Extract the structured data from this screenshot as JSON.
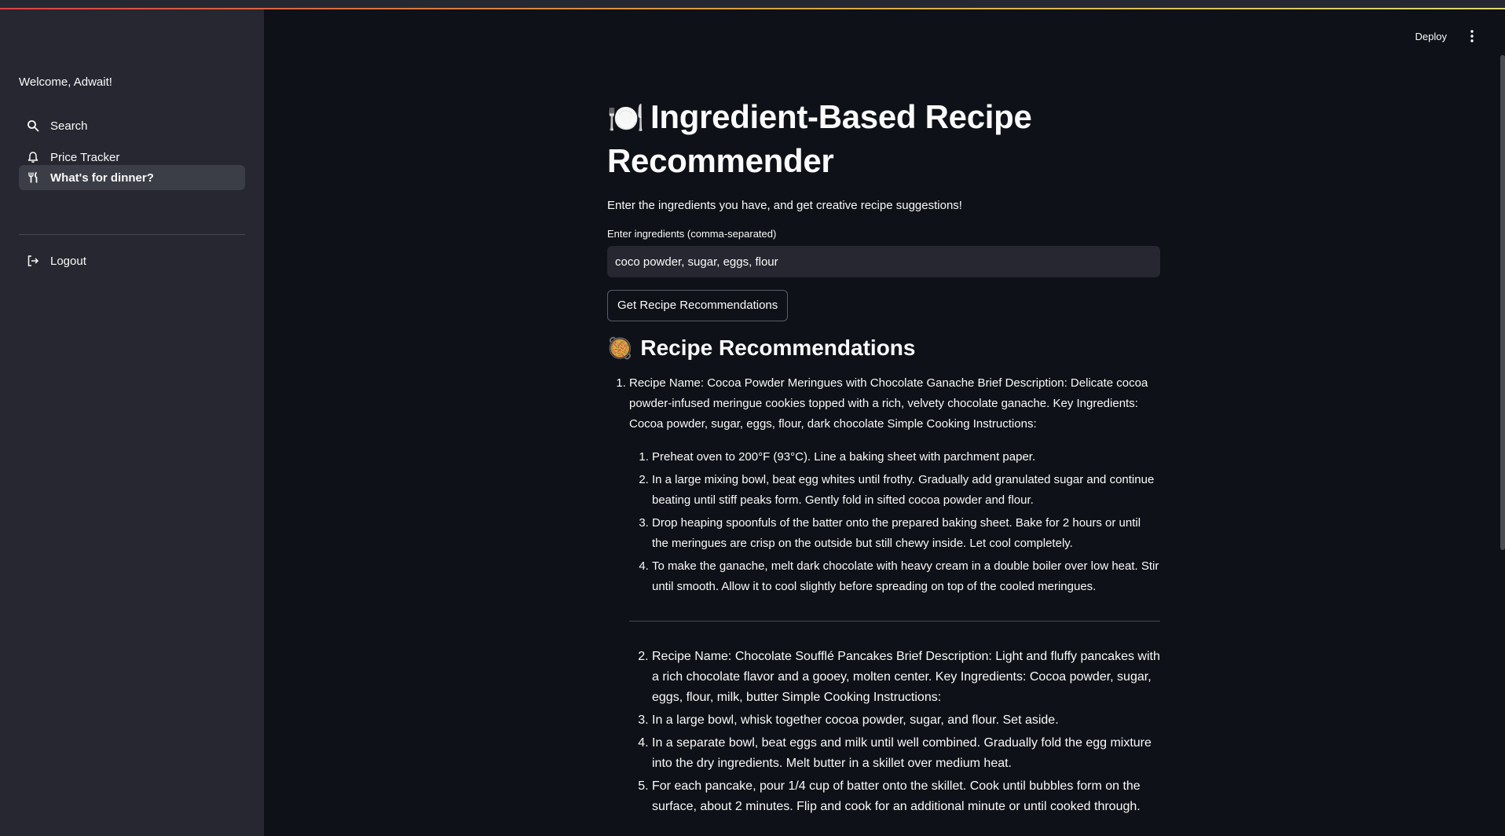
{
  "header": {
    "deploy_label": "Deploy",
    "menu_icon": "more-vertical-icon"
  },
  "sidebar": {
    "welcome": "Welcome, Adwait!",
    "items": [
      {
        "label": "Search",
        "icon": "search-icon"
      },
      {
        "label": "Price Tracker",
        "icon": "bell-icon"
      },
      {
        "label": "What's for dinner?",
        "icon": "utensils-icon",
        "active": true
      }
    ],
    "logout_label": "Logout"
  },
  "main": {
    "title_emoji": "🍽️",
    "title": "Ingredient-Based Recipe Recommender",
    "subtitle": "Enter the ingredients you have, and get creative recipe suggestions!",
    "input_label": "Enter ingredients (comma-separated)",
    "input_value": "coco powder, sugar, eggs, flour",
    "button_label": "Get Recipe Recommendations",
    "section_emoji": "🥘",
    "section_title": "Recipe Recommendations",
    "recipe1": {
      "text": "Recipe Name: Cocoa Powder Meringues with Chocolate Ganache Brief Description: Delicate cocoa powder-infused meringue cookies topped with a rich, velvety chocolate ganache. Key Ingredients: Cocoa powder, sugar, eggs, flour, dark chocolate Simple Cooking Instructions:",
      "steps": [
        "Preheat oven to 200°F (93°C). Line a baking sheet with parchment paper.",
        "In a large mixing bowl, beat egg whites until frothy. Gradually add granulated sugar and continue beating until stiff peaks form. Gently fold in sifted cocoa powder and flour.",
        "Drop heaping spoonfuls of the batter onto the prepared baking sheet. Bake for 2 hours or until the meringues are crisp on the outside but still chewy inside. Let cool completely.",
        "To make the ganache, melt dark chocolate with heavy cream in a double boiler over low heat. Stir until smooth. Allow it to cool slightly before spreading on top of the cooled meringues."
      ]
    },
    "recipe2_items": [
      "Recipe Name: Chocolate Soufflé Pancakes Brief Description: Light and fluffy pancakes with a rich chocolate flavor and a gooey, molten center. Key Ingredients: Cocoa powder, sugar, eggs, flour, milk, butter Simple Cooking Instructions:",
      "In a large bowl, whisk together cocoa powder, sugar, and flour. Set aside.",
      "In a separate bowl, beat eggs and milk until well combined. Gradually fold the egg mixture into the dry ingredients. Melt butter in a skillet over medium heat.",
      "For each pancake, pour 1/4 cup of batter onto the skillet. Cook until bubbles form on the surface, about 2 minutes. Flip and cook for an additional minute or until cooked through."
    ]
  }
}
